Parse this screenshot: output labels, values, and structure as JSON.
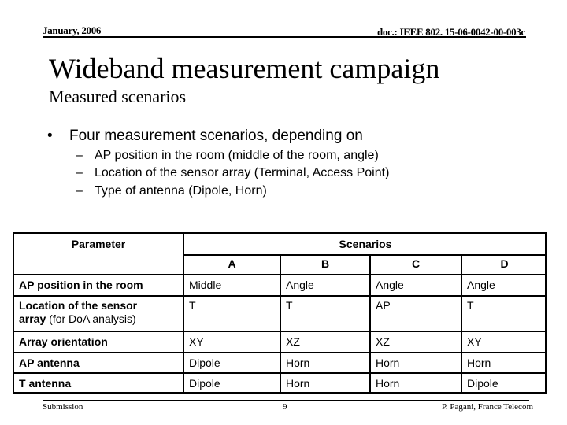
{
  "header": {
    "date": "January, 2006",
    "doc_id": "doc.: IEEE 802. 15-06-0042-00-003c"
  },
  "title": "Wideband measurement campaign",
  "subtitle": "Measured scenarios",
  "bullets": {
    "main": "Four measurement scenarios, depending on",
    "main_marker": "•",
    "sub_marker": "–",
    "sub": [
      "AP position in the room (middle of the room, angle)",
      "Location of the sensor array (Terminal, Access Point)",
      "Type of antenna (Dipole, Horn)"
    ]
  },
  "table": {
    "param_header": "Parameter",
    "scenarios_header": "Scenarios",
    "columns": [
      "A",
      "B",
      "C",
      "D"
    ],
    "rows": [
      {
        "label": "AP position in the room",
        "label_suffix": "",
        "label_line2": "",
        "values": [
          "Middle",
          "Angle",
          "Angle",
          "Angle"
        ]
      },
      {
        "label": "Location of the sensor",
        "label_line2": "array",
        "label_suffix": " (for DoA analysis)",
        "values": [
          "T",
          "T",
          "AP",
          "T"
        ]
      },
      {
        "label": "Array orientation",
        "label_suffix": "",
        "label_line2": "",
        "values": [
          "XY",
          "XZ",
          "XZ",
          "XY"
        ]
      },
      {
        "label": "AP antenna",
        "label_suffix": "",
        "label_line2": "",
        "values": [
          "Dipole",
          "Horn",
          "Horn",
          "Horn"
        ]
      },
      {
        "label": "T antenna",
        "label_suffix": "",
        "label_line2": "",
        "values": [
          "Dipole",
          "Horn",
          "Horn",
          "Dipole"
        ]
      }
    ]
  },
  "footer": {
    "left": "Submission",
    "page": "9",
    "author": "P. Pagani, France Telecom"
  }
}
